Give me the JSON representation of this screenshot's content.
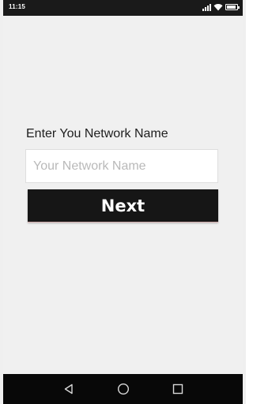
{
  "status_bar": {
    "time": "11:15",
    "icons": [
      "signal-icon",
      "wifi-icon",
      "battery-icon"
    ]
  },
  "form": {
    "prompt_label": "Enter You Network Name",
    "network_input": {
      "value": "",
      "placeholder": "Your Network Name"
    },
    "next_label": "Next"
  },
  "nav_bar": {
    "icons": [
      "back-icon",
      "home-icon",
      "recent-apps-icon"
    ]
  },
  "colors": {
    "background": "#f0f0f0",
    "button": "#161616",
    "button_text": "#ffffff",
    "status_bar": "#1a1a1a",
    "nav_bar": "#080808"
  }
}
